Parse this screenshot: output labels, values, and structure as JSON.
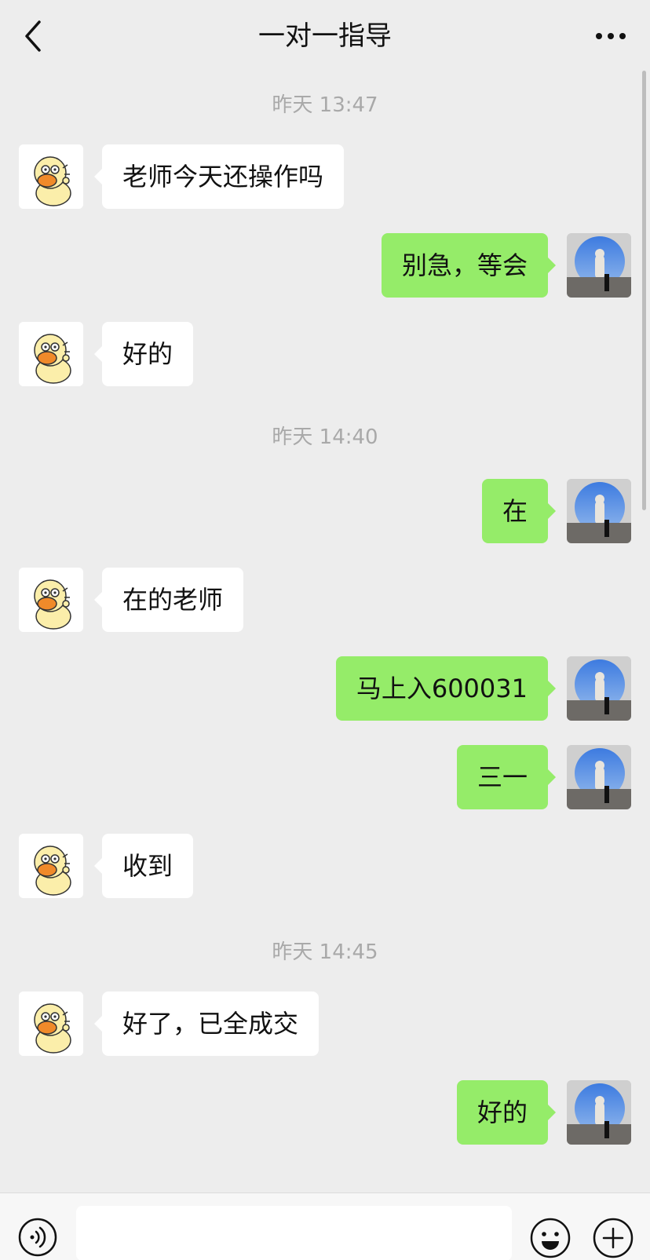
{
  "header": {
    "title": "一对一指导"
  },
  "timestamps": [
    "昨天 13:47",
    "昨天 14:40",
    "昨天 14:45"
  ],
  "messages": [
    {
      "side": "left",
      "text": "老师今天还操作吗"
    },
    {
      "side": "right",
      "text": "别急，等会"
    },
    {
      "side": "left",
      "text": "好的"
    },
    {
      "side": "right",
      "text": "在"
    },
    {
      "side": "left",
      "text": "在的老师"
    },
    {
      "side": "right",
      "text": "马上入600031"
    },
    {
      "side": "right",
      "text": "三一"
    },
    {
      "side": "left",
      "text": "收到"
    },
    {
      "side": "left",
      "text": "好了，已全成交"
    },
    {
      "side": "right",
      "text": "好的"
    }
  ],
  "input": {
    "value": "",
    "placeholder": ""
  },
  "icons": {
    "back": "chevron-left-icon",
    "more": "more-dots-icon",
    "voice": "voice-icon",
    "emoji": "emoji-icon",
    "plus": "plus-icon"
  },
  "colors": {
    "background": "#ededed",
    "bubble_self": "#95ec69",
    "bubble_other": "#ffffff",
    "timestamp_text": "#a9a9a9"
  }
}
